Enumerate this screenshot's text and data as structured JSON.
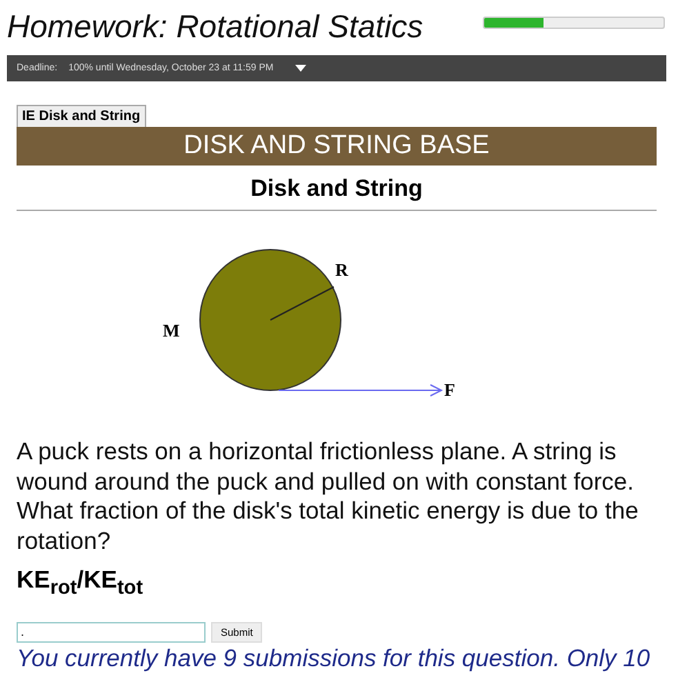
{
  "header": {
    "title": "Homework: Rotational Statics",
    "progress": {
      "level": 0.33
    }
  },
  "deadline": {
    "label": "Deadline:",
    "text": "100% until Wednesday, October 23 at 11:59 PM"
  },
  "problem": {
    "tab": "IE Disk and String",
    "banner": "DISK AND STRING BASE",
    "title": "Disk and String",
    "figure": {
      "labels": [
        "M",
        "R",
        "F"
      ]
    },
    "question": "A puck rests on a horizontal frictionless plane. A string is wound around the puck and pulled on with constant force. What fraction of the disk's total kinetic energy is due to the rotation?",
    "quantity": "KE$_{rot}$/KE$_{tot}$",
    "answer": {
      "value": "."
    },
    "submit": "Submit",
    "note": "You currently have 9 submissions for this question. Only 10"
  }
}
